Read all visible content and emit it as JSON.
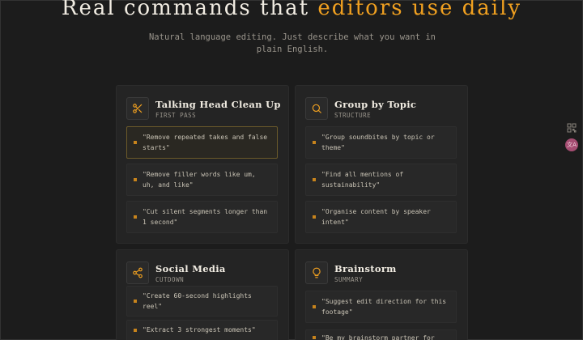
{
  "hero": {
    "title_main": "Real commands that",
    "title_accent": "editors use daily",
    "subtitle": "Natural language editing. Just describe what you want in plain English."
  },
  "colors": {
    "accent": "#f0a020",
    "background": "#1c1c1c",
    "card": "#242424"
  },
  "cards": [
    {
      "title": "Talking Head Clean Up",
      "subtitle": "FIRST PASS",
      "icon": "scissors-icon",
      "commands": [
        "\"Remove repeated takes and false starts\"",
        "\"Remove filler words like um, uh, and like\"",
        "\"Cut silent segments longer than 1 second\""
      ]
    },
    {
      "title": "Group by Topic",
      "subtitle": "STRUCTURE",
      "icon": "search-icon",
      "commands": [
        "\"Group soundbites by topic or theme\"",
        "\"Find all mentions of sustainability\"",
        "\"Organise content by speaker intent\""
      ]
    },
    {
      "title": "Social Media",
      "subtitle": "CUTDOWN",
      "icon": "share-icon",
      "commands": [
        "\"Create 60-second highlights reel\"",
        "\"Extract 3 strongest moments\""
      ]
    },
    {
      "title": "Brainstorm",
      "subtitle": "SUMMARY",
      "icon": "lightbulb-icon",
      "commands": [
        "\"Suggest edit direction for this footage\"",
        "\"Be my brainstorm partner for"
      ]
    }
  ],
  "sidebar": {
    "avatar_label": "文A"
  }
}
